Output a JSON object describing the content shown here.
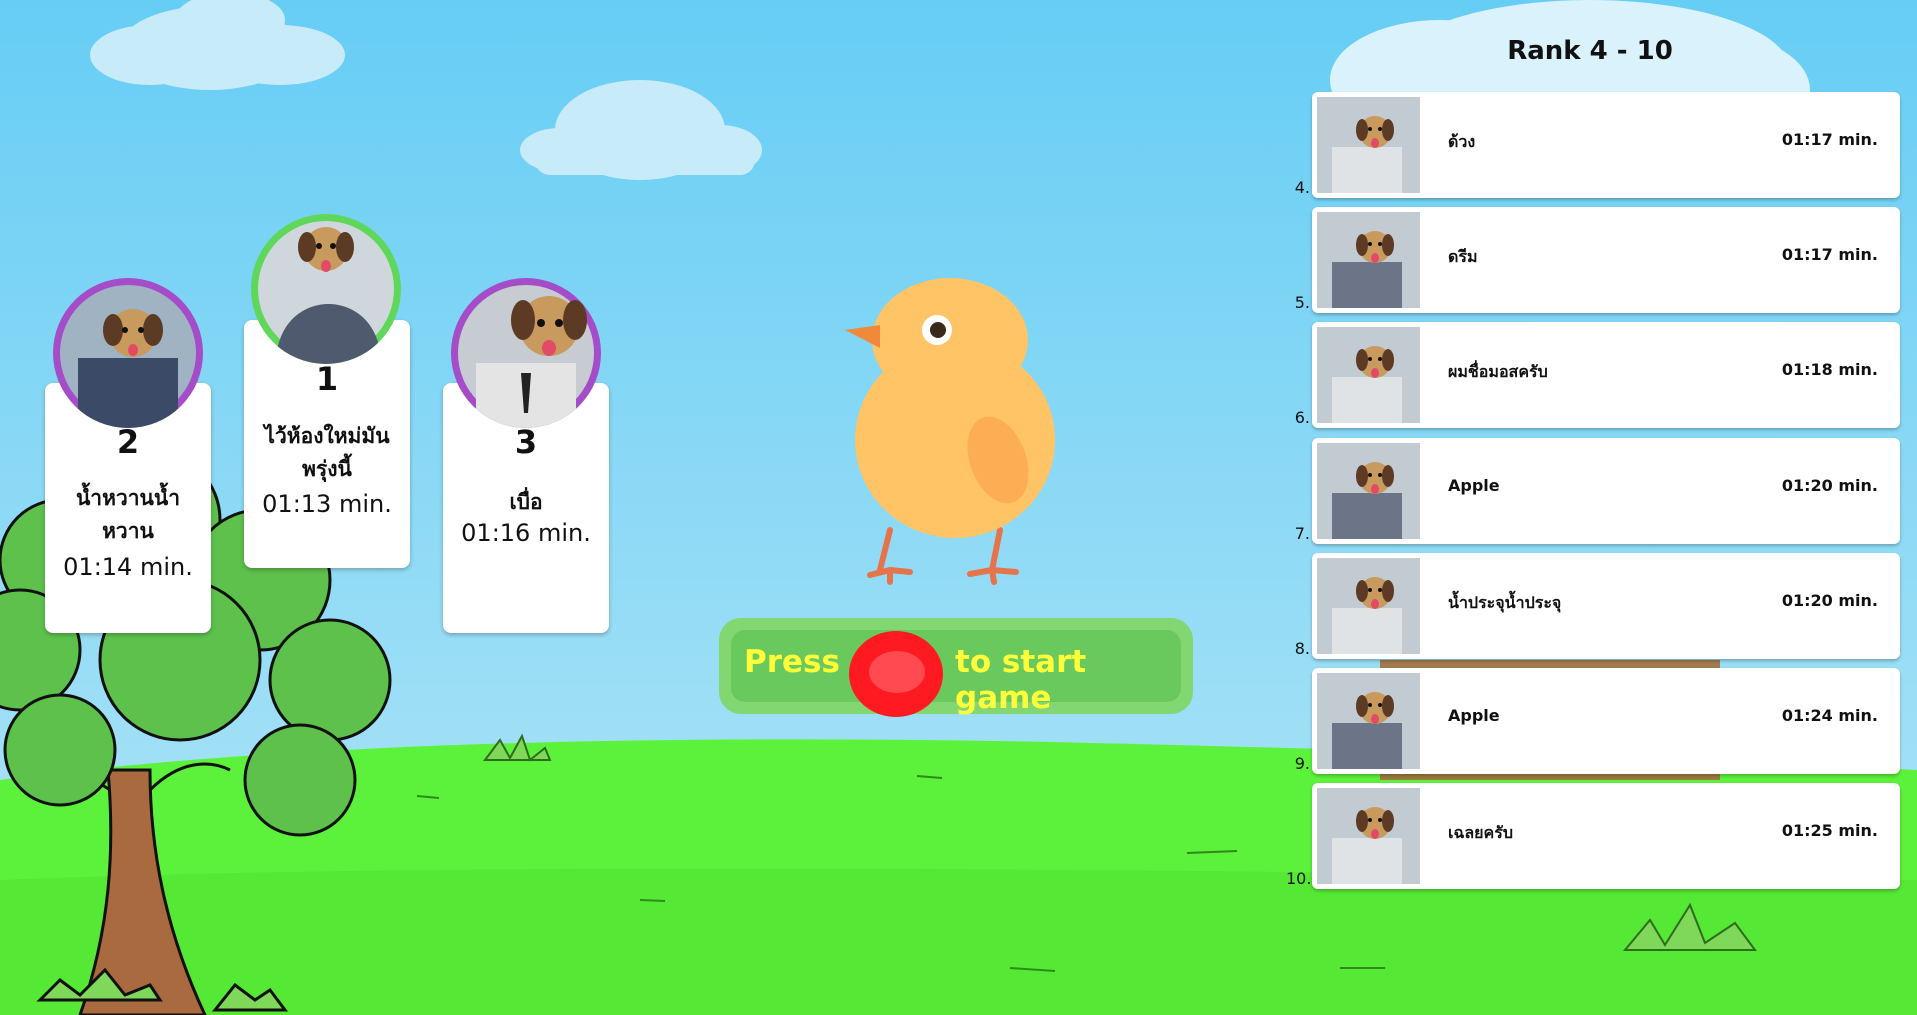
{
  "podium": [
    {
      "place": "1",
      "name": "ไว้ห้องใหม่มันพรุ่งนี้",
      "time": "01:13 min.",
      "ring_color": "#5fd75a"
    },
    {
      "place": "2",
      "name": "น้ำหวานน้ำหวาน",
      "time": "01:14 min.",
      "ring_color": "#a54cc9"
    },
    {
      "place": "3",
      "name": "เบื่อ",
      "time": "01:16 min.",
      "ring_color": "#a54cc9"
    }
  ],
  "start_button": {
    "press_label": "Press",
    "after_label": "to start game",
    "button_color": "#ff1a22",
    "text_color": "#ffff3a"
  },
  "leaderboard": {
    "title": "Rank 4 - 10",
    "rows": [
      {
        "index": "4.",
        "name": "ด้วง",
        "time": "01:17 min."
      },
      {
        "index": "5.",
        "name": "ดรีม",
        "time": "01:17 min."
      },
      {
        "index": "6.",
        "name": "ผมชื่อมอสครับ",
        "time": "01:18 min."
      },
      {
        "index": "7.",
        "name": "Apple",
        "time": "01:20 min."
      },
      {
        "index": "8.",
        "name": "น้ำประจุน้ำประจุ",
        "time": "01:20 min."
      },
      {
        "index": "9.",
        "name": "Apple",
        "time": "01:24 min."
      },
      {
        "index": "10.",
        "name": "เฉลยครับ",
        "time": "01:25 min."
      }
    ]
  },
  "icons": {
    "mascot": "chick-icon",
    "avatar_overlay": "dog-face-icon"
  }
}
